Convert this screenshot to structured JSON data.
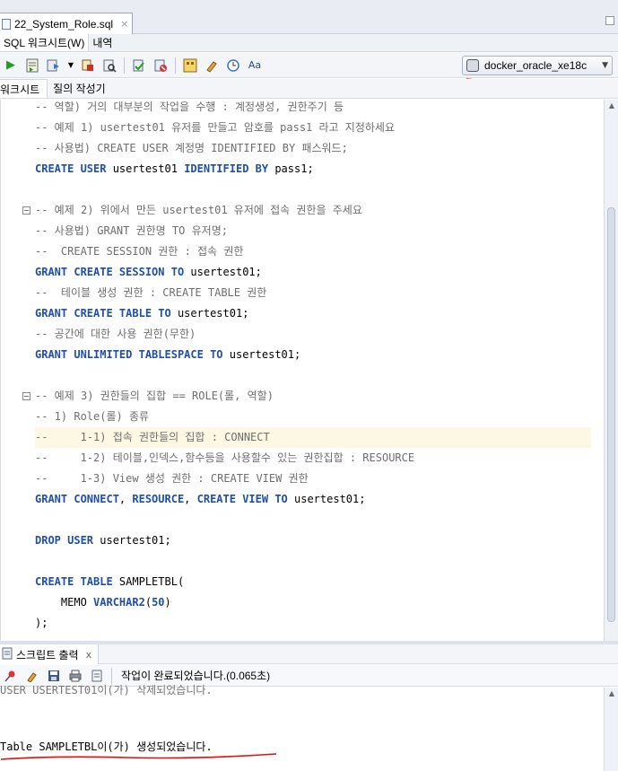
{
  "file_tab": {
    "label": "22_System_Role.sql",
    "close": "×"
  },
  "subtabs": [
    "SQL 워크시트(W)",
    "내역"
  ],
  "connection": {
    "label": "docker_oracle_xe18c"
  },
  "editor_tabs": [
    "워크시트",
    "질의 작성기"
  ],
  "code_lines": [
    [
      [
        "cm",
        "-- 역할) 거의 대부분의 작업을 수행 : 계정생성, 권한주기 등"
      ]
    ],
    [
      [
        "cm",
        "-- 예제 1) usertest01 유저를 만들고 암호를 pass1 라고 지정하세요"
      ]
    ],
    [
      [
        "cm",
        "-- 사용법) CREATE USER 계정명 IDENTIFIED BY 패스워드;"
      ]
    ],
    [
      [
        "kw",
        "CREATE USER"
      ],
      [
        "tx",
        " usertest01 "
      ],
      [
        "kw",
        "IDENTIFIED BY"
      ],
      [
        "tx",
        " pass1;"
      ]
    ],
    [],
    [
      [
        "cm",
        "-- 예제 2) 위에서 만든 usertest01 유저에 접속 권한을 주세요"
      ]
    ],
    [
      [
        "cm",
        "-- 사용법) GRANT 권한명 TO 유저명;"
      ]
    ],
    [
      [
        "cm",
        "--  CREATE SESSION 권한 : 접속 권한"
      ]
    ],
    [
      [
        "kw",
        "GRANT CREATE SESSION TO"
      ],
      [
        "tx",
        " usertest01;"
      ]
    ],
    [
      [
        "cm",
        "--  테이블 생성 권한 : CREATE TABLE 권한"
      ]
    ],
    [
      [
        "kw",
        "GRANT CREATE TABLE TO"
      ],
      [
        "tx",
        " usertest01;"
      ]
    ],
    [
      [
        "cm",
        "-- 공간에 대한 사용 권한(무한)"
      ]
    ],
    [
      [
        "kw",
        "GRANT UNLIMITED TABLESPACE TO"
      ],
      [
        "tx",
        " usertest01;"
      ]
    ],
    [],
    [
      [
        "cm",
        "-- 예제 3) 권한들의 집합 == ROLE(롤, 역할)"
      ]
    ],
    [
      [
        "cm",
        "-- 1) Role(롤) 종류"
      ]
    ],
    [
      [
        "cm",
        "--     1-1) 접속 권한들의 집합 : CONNECT"
      ]
    ],
    [
      [
        "cm",
        "--     1-2) 테이블,인덱스,함수등을 사용할수 있는 권한집합 : RESOURCE"
      ]
    ],
    [
      [
        "cm",
        "--     1-3) View 생성 권한 : CREATE VIEW 권한"
      ]
    ],
    [
      [
        "kw",
        "GRANT CONNECT"
      ],
      [
        "tx",
        ", "
      ],
      [
        "kw",
        "RESOURCE"
      ],
      [
        "tx",
        ", "
      ],
      [
        "kw",
        "CREATE VIEW TO"
      ],
      [
        "tx",
        " usertest01;"
      ]
    ],
    [],
    [
      [
        "kw",
        "DROP USER"
      ],
      [
        "tx",
        " usertest01;"
      ]
    ],
    [],
    [
      [
        "kw",
        "CREATE TABLE"
      ],
      [
        "tx",
        " SAMPLETBL("
      ]
    ],
    [
      [
        "tx",
        "    MEMO "
      ],
      [
        "kw",
        "VARCHAR2"
      ],
      [
        "tx",
        "("
      ],
      [
        "kw",
        "50"
      ],
      [
        "tx",
        ")"
      ]
    ],
    [
      [
        "tx",
        ");"
      ]
    ]
  ],
  "highlight_line": 16,
  "fold_lines": [
    5,
    14
  ],
  "output_tab": {
    "label": "스크립트 출력",
    "close": "x"
  },
  "output_status": "작업이 완료되었습니다.(0.065초)",
  "output_prev": "USER USERTEST01이(가) 삭제되었습니다.",
  "output_message": "Table SAMPLETBL이(가) 생성되었습니다.",
  "accent_red": "#e01010"
}
